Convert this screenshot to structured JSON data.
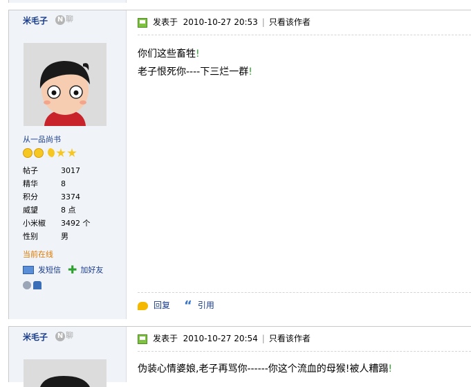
{
  "posts": [
    {
      "username": "米毛子",
      "online_badge": "聊",
      "rank_title": "从一品尚书",
      "stats": [
        {
          "key": "帖子",
          "value": "3017"
        },
        {
          "key": "精华",
          "value": "8"
        },
        {
          "key": "积分",
          "value": "3374"
        },
        {
          "key": "威望",
          "value": "8 点"
        },
        {
          "key": "小米椒",
          "value": "3492 个"
        },
        {
          "key": "性别",
          "value": "男"
        }
      ],
      "online_status": "当前在线",
      "send_message": "发短信",
      "add_friend": "加好友",
      "posted_label": "发表于",
      "posted_time": "2010-10-27 20:53",
      "separator": "|",
      "author_only": "只看该作者",
      "lines": [
        {
          "text": "你们这些畜牲",
          "end": "!"
        },
        {
          "text": "老子恨死你----下三烂一群",
          "end": "!"
        }
      ],
      "reply": "回复",
      "quote": "引用"
    },
    {
      "username": "米毛子",
      "online_badge": "聊",
      "posted_label": "发表于",
      "posted_time": "2010-10-27 20:54",
      "separator": "|",
      "author_only": "只看该作者",
      "lines": [
        {
          "text": "伪装心情婆娘,老子再骂你------你这个流血的母猴!被人糟蹋",
          "end": "!"
        }
      ]
    }
  ],
  "colors": {
    "sidebar_bg": "#f0f3f8",
    "link": "#173a8a",
    "online": "#e07a00",
    "accent_green": "#2ea22e"
  }
}
